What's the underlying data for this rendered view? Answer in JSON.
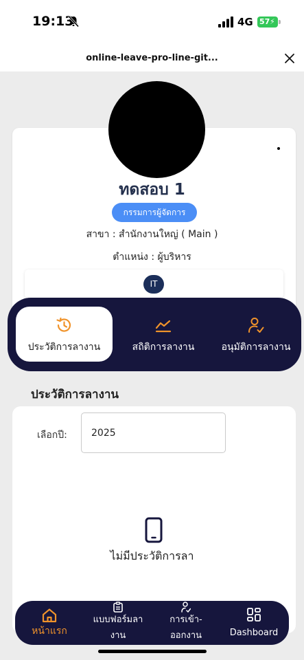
{
  "status_bar": {
    "time": "19:13",
    "network": "4G",
    "battery": "57"
  },
  "browser": {
    "url_title": "online-leave-pro-line-git..."
  },
  "profile": {
    "name": "ทดสอบ 1",
    "role": "กรรมการผู้จัดการ",
    "branch": "สาขา : สำนักงานใหญ่ ( Main )",
    "position": "ตำแหน่ง : ผู้บริหาร",
    "department": "IT"
  },
  "tabs": [
    {
      "label": "ประวัติการลางาน",
      "icon": "history-icon",
      "active": true
    },
    {
      "label": "สถิติการลางาน",
      "icon": "chart-line-icon",
      "active": false
    },
    {
      "label": "อนุมัติการลางาน",
      "icon": "user-check-icon",
      "active": false
    }
  ],
  "history": {
    "title": "ประวัติการลางาน",
    "year_label": "เลือกปี:",
    "year_value": "2025",
    "empty_text": "ไม่มีประวัติการลา"
  },
  "bottom_nav": [
    {
      "label": "หน้าแรก",
      "icon": "home-icon",
      "active": true
    },
    {
      "label_lines": [
        "แบบฟอร์มลา",
        "งาน"
      ],
      "icon": "clipboard-icon",
      "active": false
    },
    {
      "label_lines": [
        "การเข้า-",
        "ออกงาน"
      ],
      "icon": "user-clock-icon",
      "active": false
    },
    {
      "label": "Dashboard",
      "icon": "dashboard-icon",
      "active": false
    }
  ],
  "colors": {
    "accent": "#f0932b",
    "navy": "#16163d",
    "role_badge": "#4b8ef6",
    "name_text": "#24304d",
    "battery": "#34c759"
  }
}
